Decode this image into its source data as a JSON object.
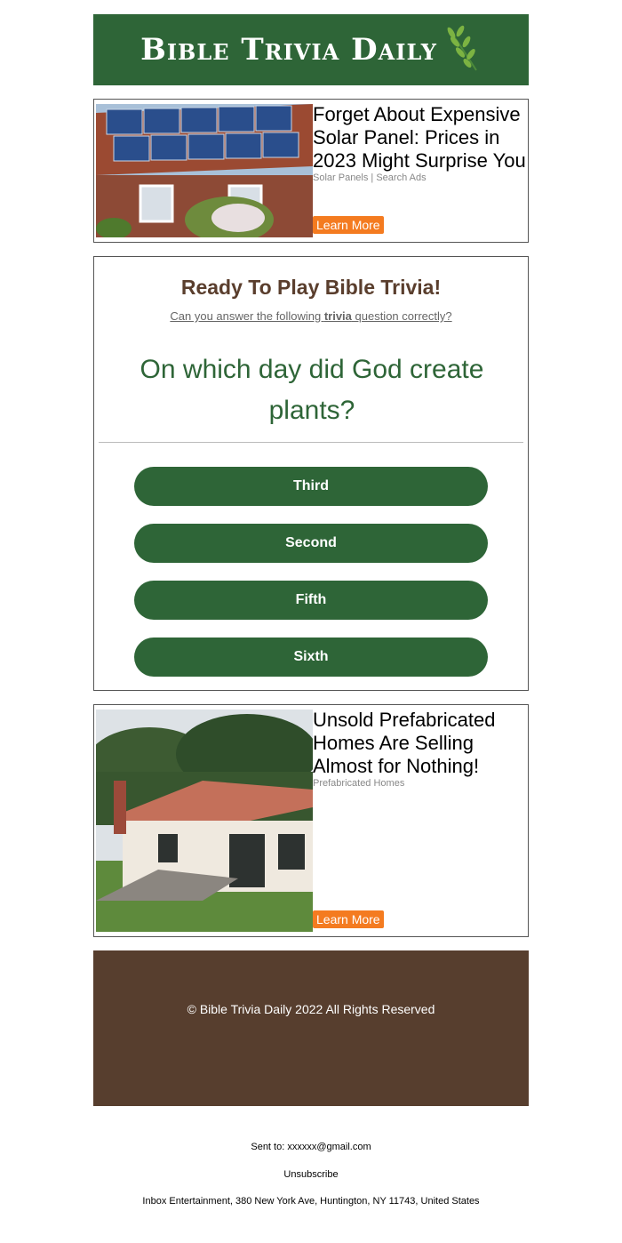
{
  "header": {
    "brand": "Bible Trivia Daily",
    "logo_icon": "olive-branch-icon",
    "bg_color": "#2e6537"
  },
  "ad_top": {
    "title": "Forget About Expensive Solar Panel: Prices in 2023 Might Surprise You",
    "source": "Solar Panels | Search Ads",
    "button": "Learn More",
    "image": "solar-panel-roof-image"
  },
  "quiz": {
    "title": "Ready To Play Bible Trivia!",
    "subtitle_pre": "Can you answer the following ",
    "subtitle_bold": "trivia",
    "subtitle_post": " question correctly?",
    "question": "On which day did God create plants?",
    "answers": [
      "Third",
      "Second",
      "Fifth",
      "Sixth"
    ]
  },
  "ad_bottom": {
    "title": "Unsold Prefabricated Homes Are Selling Almost for Nothing!",
    "source": "Prefabricated Homes",
    "button": "Learn More",
    "image": "prefab-house-image"
  },
  "footer": {
    "copyright": "© Bible Trivia Daily 2022 All Rights Reserved",
    "bg_color": "#573e2e"
  },
  "meta": {
    "sent_to": "Sent to: xxxxxx@gmail.com",
    "unsubscribe": "Unsubscribe",
    "address": "Inbox Entertainment, 380 New York Ave, Huntington, NY 11743, United States"
  },
  "colors": {
    "button_orange": "#f47b20",
    "title_brown": "#5a3e2d"
  }
}
